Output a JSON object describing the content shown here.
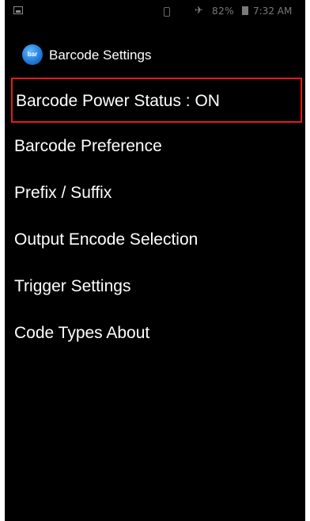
{
  "status_bar": {
    "signal_icon": "airplane-signal-icon",
    "battery_text": "82%",
    "time": "7:32 AM",
    "icons": [
      "image-notification-icon",
      "vibrate-icon",
      "battery-icon"
    ]
  },
  "action_bar": {
    "icon": "barcode-app-icon",
    "icon_text": "bar",
    "title": "Barcode Settings"
  },
  "menu": {
    "items": [
      {
        "label": "Barcode Power Status : ON",
        "selected": true
      },
      {
        "label": "Barcode Preference"
      },
      {
        "label": "Prefix / Suffix"
      },
      {
        "label": "Output Encode Selection"
      },
      {
        "label": "Trigger Settings"
      },
      {
        "label": "Code Types About"
      }
    ]
  },
  "colors": {
    "background": "#000000",
    "text": "#ffffff",
    "selection_border": "#e41b1b"
  }
}
